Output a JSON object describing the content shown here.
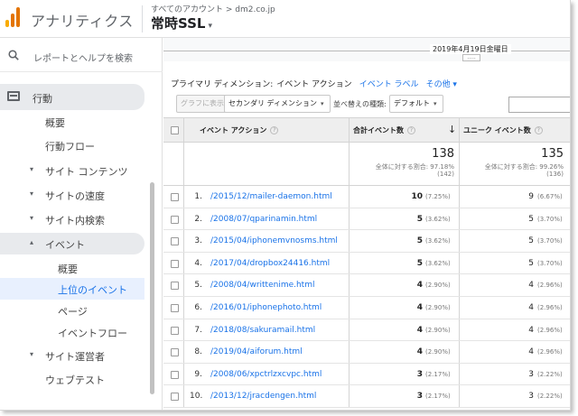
{
  "header": {
    "app_title": "アナリティクス",
    "breadcrumb": "すべてのアカウント > dm2.co.jp",
    "property": "常時SSL",
    "property_caret": "▾"
  },
  "sidebar": {
    "search_label": "レポートとヘルプを検索",
    "section": "行動",
    "items": [
      {
        "label": "概要",
        "arrow": ""
      },
      {
        "label": "行動フロー",
        "arrow": ""
      },
      {
        "label": "サイト コンテンツ",
        "arrow": "▾"
      },
      {
        "label": "サイトの速度",
        "arrow": "▾"
      },
      {
        "label": "サイト内検索",
        "arrow": "▾"
      },
      {
        "label": "イベント",
        "arrow": "▴"
      },
      {
        "label": "概要",
        "arrow": ""
      },
      {
        "label": "上位のイベント",
        "arrow": ""
      },
      {
        "label": "ページ",
        "arrow": ""
      },
      {
        "label": "イベントフロー",
        "arrow": ""
      },
      {
        "label": "サイト運営者",
        "arrow": "▾"
      },
      {
        "label": "ウェブテスト",
        "arrow": ""
      }
    ]
  },
  "date": {
    "label": "2019年4月19日金曜日",
    "marker": "....."
  },
  "dimensions": {
    "label": "プライマリ ディメンション:",
    "active": "イベント アクション",
    "link1": "イベント ラベル",
    "link2": "その他 ▾"
  },
  "toolbar": {
    "graph_button": "グラフに表示",
    "secondary_dim": "セカンダリ ディメンション",
    "sort_label": "並べ替えの種類:",
    "sort_value": "デフォルト",
    "dropdown_caret": "▾",
    "search_placeholder": ""
  },
  "table": {
    "col_action": "イベント アクション",
    "col_total": "合計イベント数",
    "col_unique": "ユニーク イベント数",
    "help_glyph": "?",
    "sort_arrow": "↓",
    "totals": {
      "total": "138",
      "total_sub1": "全体に対する割合: 97.18%",
      "total_sub2": "(142)",
      "unique": "135",
      "unique_sub1": "全体に対する割合: 99.26%",
      "unique_sub2": "(136)"
    },
    "rows": [
      {
        "n": "1.",
        "action": "/2015/12/mailer-daemon.html",
        "total": "10",
        "tpct": "(7.25%)",
        "unique": "9",
        "upct": "(6.67%)"
      },
      {
        "n": "2.",
        "action": "/2008/07/qparinamin.html",
        "total": "5",
        "tpct": "(3.62%)",
        "unique": "5",
        "upct": "(3.70%)"
      },
      {
        "n": "3.",
        "action": "/2015/04/iphonemvnosms.html",
        "total": "5",
        "tpct": "(3.62%)",
        "unique": "5",
        "upct": "(3.70%)"
      },
      {
        "n": "4.",
        "action": "/2017/04/dropbox24416.html",
        "total": "5",
        "tpct": "(3.62%)",
        "unique": "5",
        "upct": "(3.70%)"
      },
      {
        "n": "5.",
        "action": "/2008/04/writtenime.html",
        "total": "4",
        "tpct": "(2.90%)",
        "unique": "4",
        "upct": "(2.96%)"
      },
      {
        "n": "6.",
        "action": "/2016/01/iphonephoto.html",
        "total": "4",
        "tpct": "(2.90%)",
        "unique": "4",
        "upct": "(2.96%)"
      },
      {
        "n": "7.",
        "action": "/2018/08/sakuramail.html",
        "total": "4",
        "tpct": "(2.90%)",
        "unique": "4",
        "upct": "(2.96%)"
      },
      {
        "n": "8.",
        "action": "/2019/04/aiforum.html",
        "total": "4",
        "tpct": "(2.90%)",
        "unique": "4",
        "upct": "(2.96%)"
      },
      {
        "n": "9.",
        "action": "/2008/06/xpctrlzxcvpc.html",
        "total": "3",
        "tpct": "(2.17%)",
        "unique": "3",
        "upct": "(2.22%)"
      },
      {
        "n": "10.",
        "action": "/2013/12/jracdengen.html",
        "total": "3",
        "tpct": "(2.17%)",
        "unique": "3",
        "upct": "(2.22%)"
      }
    ]
  },
  "colors": {
    "accent": "#1a73e8",
    "logo_orange": "#e37400",
    "logo_yellow": "#f9ab00"
  }
}
